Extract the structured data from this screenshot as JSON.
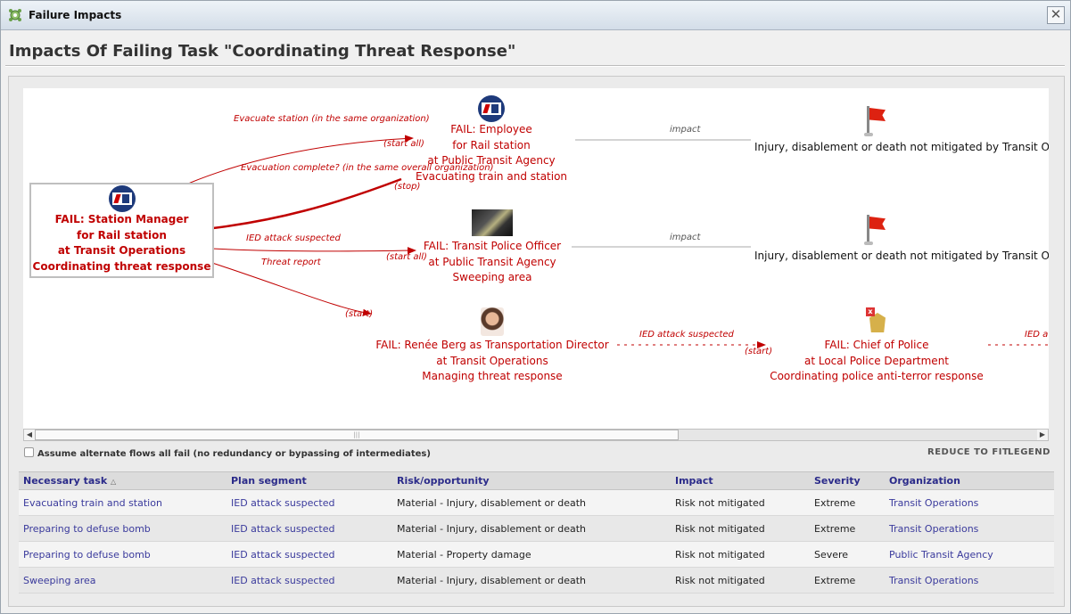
{
  "window": {
    "title": "Failure Impacts",
    "close": "✕"
  },
  "page": {
    "title": "Impacts Of Failing Task \"Coordinating Threat Response\""
  },
  "diagram": {
    "main_node": {
      "lines": [
        "FAIL: Station Manager",
        "for Rail station",
        "at Transit Operations",
        "Coordinating threat response"
      ]
    },
    "employee_node": {
      "lines": [
        "FAIL: Employee",
        "for Rail station",
        "at Public Transit Agency",
        "Evacuating train and station"
      ]
    },
    "police_officer_node": {
      "lines": [
        "FAIL: Transit Police Officer",
        "at Public Transit Agency",
        "Sweeping area"
      ]
    },
    "director_node": {
      "lines": [
        "FAIL: Renée Berg as Transportation Director",
        "at Transit Operations",
        "Managing threat response"
      ]
    },
    "chief_node": {
      "lines": [
        "FAIL: Chief of Police",
        "at Local Police Department",
        "Coordinating police anti-terror response"
      ]
    },
    "harm1": {
      "lines": [
        "Injury, disablement or death not mitigated by",
        "Transit Operations"
      ]
    },
    "harm2": {
      "lines": [
        "Injury, disablement or death not mitigated by",
        "Transit Operations"
      ]
    },
    "edges": {
      "evacuate_station": [
        "Evacuate station",
        "(in the same organization)"
      ],
      "evacuation_complete": [
        "Evacuation complete?",
        "(in the same overall",
        "organization)"
      ],
      "ied_attack": "IED attack suspected",
      "threat_report": "Threat report",
      "ied_attack_2": "IED attack suspected",
      "ied_attack_3": "IED a",
      "start_all_1": "(start all)",
      "stop": "(stop)",
      "start_all_2": "(start all)",
      "start_1": "(start)",
      "start_2": "(start)",
      "impact_1": "impact",
      "impact_2": "impact"
    }
  },
  "scrollbar": {
    "grip": "|||",
    "left_arrow": "◀",
    "right_arrow": "▶"
  },
  "options": {
    "alternate_flows": "Assume alternate flows all fail (no redundancy or bypassing of intermediates)",
    "reduce_to_fit": "REDUCE TO FIT",
    "legend": "LEGEND"
  },
  "table": {
    "columns": [
      "Necessary task",
      "Plan segment",
      "Risk/opportunity",
      "Impact",
      "Severity",
      "Organization"
    ],
    "sort_indicator": "△",
    "rows": [
      [
        "Evacuating train and station",
        "IED attack suspected",
        "Material - Injury, disablement or death",
        "Risk not mitigated",
        "Extreme",
        "Transit Operations"
      ],
      [
        "Preparing to defuse bomb",
        "IED attack suspected",
        "Material - Injury, disablement or death",
        "Risk not mitigated",
        "Extreme",
        "Transit Operations"
      ],
      [
        "Preparing to defuse bomb",
        "IED attack suspected",
        "Material - Property damage",
        "Risk not mitigated",
        "Severe",
        "Public Transit Agency"
      ],
      [
        "Sweeping area",
        "IED attack suspected",
        "Material - Injury, disablement or death",
        "Risk not mitigated",
        "Extreme",
        "Transit Operations"
      ]
    ]
  }
}
